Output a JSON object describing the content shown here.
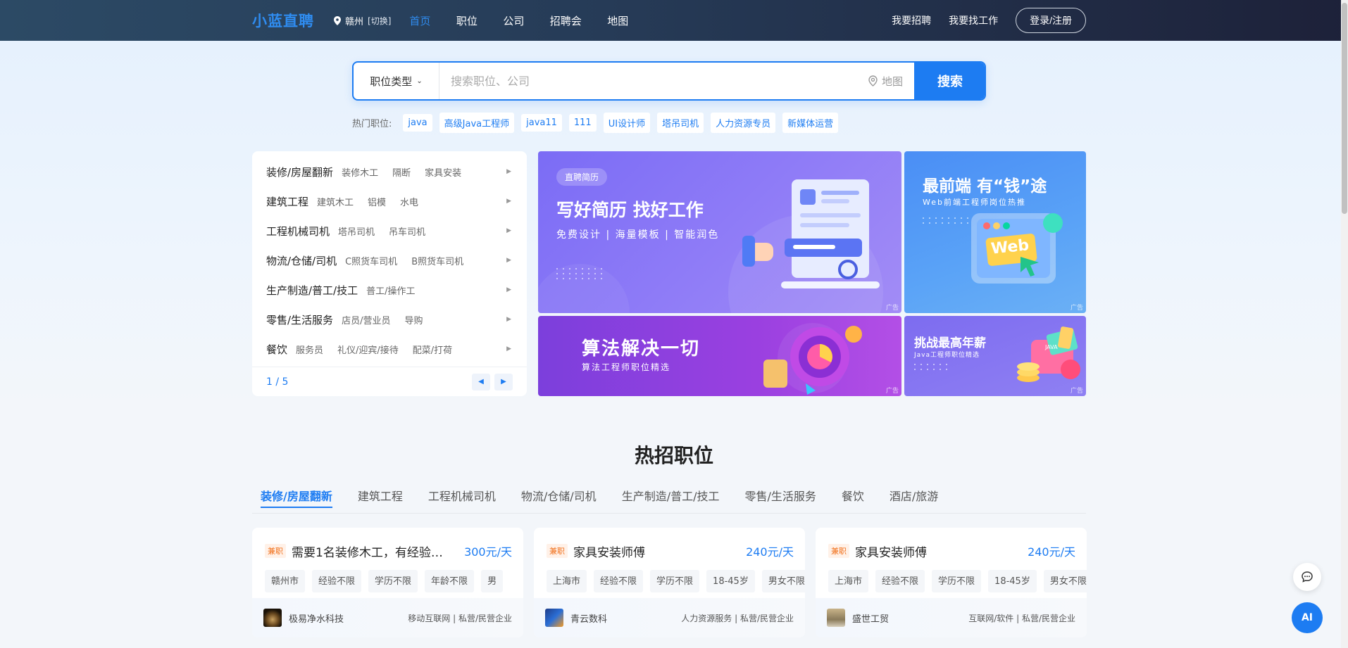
{
  "header": {
    "logo": "小蓝直聘",
    "city": "赣州",
    "city_switch": "[切换]",
    "nav": [
      "首页",
      "职位",
      "公司",
      "招聘会",
      "地图"
    ],
    "recruit": "我要招聘",
    "find_job": "我要找工作",
    "login": "登录/注册"
  },
  "search": {
    "job_type": "职位类型",
    "placeholder": "搜索职位、公司",
    "map": "地图",
    "button": "搜索"
  },
  "hot": {
    "label": "热门职位:",
    "tags": [
      "java",
      "高级Java工程师",
      "java11",
      "111",
      "UI设计师",
      "塔吊司机",
      "人力资源专员",
      "新媒体运营"
    ]
  },
  "categories": {
    "rows": [
      {
        "main": "装修/房屋翻新",
        "subs": [
          "装修木工",
          "隔断",
          "家具安装"
        ]
      },
      {
        "main": "建筑工程",
        "subs": [
          "建筑木工",
          "铝模",
          "水电"
        ]
      },
      {
        "main": "工程机械司机",
        "subs": [
          "塔吊司机",
          "吊车司机"
        ]
      },
      {
        "main": "物流/仓储/司机",
        "subs": [
          "C照货车司机",
          "B照货车司机"
        ]
      },
      {
        "main": "生产制造/普工/技工",
        "subs": [
          "普工/操作工"
        ]
      },
      {
        "main": "零售/生活服务",
        "subs": [
          "店员/营业员",
          "导购"
        ]
      },
      {
        "main": "餐饮",
        "subs": [
          "服务员",
          "礼仪/迎宾/接待",
          "配菜/打荷"
        ]
      }
    ],
    "page": "1 / 5"
  },
  "banners": {
    "b1": {
      "pill": "直聘简历",
      "title": "写好简历 找好工作",
      "sub": "免费设计 | 海量模板 | 智能润色",
      "ad": "广告"
    },
    "b2": {
      "title": "最前端 有“钱”途",
      "sub": "Web前端工程师岗位热推",
      "word": "Web",
      "ad": "广告"
    },
    "b3": {
      "title": "算法解决一切",
      "sub": "算法工程师职位精选",
      "ad": "广告"
    },
    "b4": {
      "title": "挑战最高年薪",
      "sub": "Java工程师职位精选",
      "word": "JAVA",
      "ad": "广告"
    }
  },
  "section": {
    "title": "热招职位",
    "tabs": [
      "装修/房屋翻新",
      "建筑工程",
      "工程机械司机",
      "物流/仓储/司机",
      "生产制造/普工/技工",
      "零售/生活服务",
      "餐饮",
      "酒店/旅游"
    ]
  },
  "jobs": [
    {
      "badge": "兼职",
      "title": "需要1名装修木工，有经验…",
      "salary": "300元/天",
      "tags": [
        "赣州市",
        "经验不限",
        "学历不限",
        "年龄不限",
        "男"
      ],
      "company": "极易净水科技",
      "industry": "移动互联网 | 私营/民营企业"
    },
    {
      "badge": "兼职",
      "title": "家具安装师傅",
      "salary": "240元/天",
      "tags": [
        "上海市",
        "经验不限",
        "学历不限",
        "18-45岁",
        "男女不限"
      ],
      "company": "青云数科",
      "industry": "人力资源服务 | 私营/民营企业"
    },
    {
      "badge": "兼职",
      "title": "家具安装师傅",
      "salary": "240元/天",
      "tags": [
        "上海市",
        "经验不限",
        "学历不限",
        "18-45岁",
        "男女不限"
      ],
      "company": "盛世工贸",
      "industry": "互联网/软件 | 私营/民营企业"
    }
  ],
  "float": {
    "ai": "AI"
  },
  "colors": {
    "accent": "#1d7cf2",
    "header_start": "#2c4a65",
    "header_end": "#1d2139",
    "part_time": "#f1711c"
  }
}
